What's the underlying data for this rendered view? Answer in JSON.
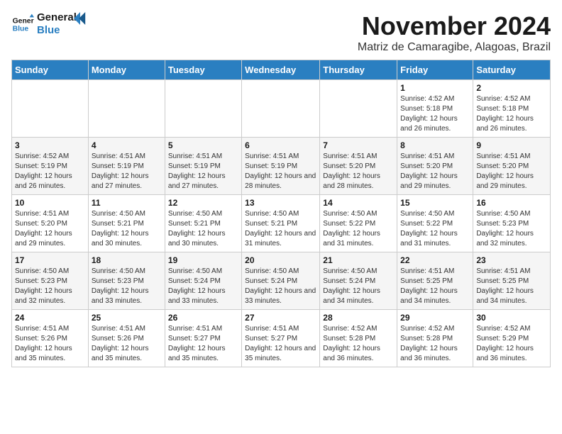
{
  "header": {
    "logo_line1": "General",
    "logo_line2": "Blue",
    "month_title": "November 2024",
    "location": "Matriz de Camaragibe, Alagoas, Brazil"
  },
  "weekdays": [
    "Sunday",
    "Monday",
    "Tuesday",
    "Wednesday",
    "Thursday",
    "Friday",
    "Saturday"
  ],
  "weeks": [
    [
      {
        "day": "",
        "info": ""
      },
      {
        "day": "",
        "info": ""
      },
      {
        "day": "",
        "info": ""
      },
      {
        "day": "",
        "info": ""
      },
      {
        "day": "",
        "info": ""
      },
      {
        "day": "1",
        "info": "Sunrise: 4:52 AM\nSunset: 5:18 PM\nDaylight: 12 hours and 26 minutes."
      },
      {
        "day": "2",
        "info": "Sunrise: 4:52 AM\nSunset: 5:18 PM\nDaylight: 12 hours and 26 minutes."
      }
    ],
    [
      {
        "day": "3",
        "info": "Sunrise: 4:52 AM\nSunset: 5:19 PM\nDaylight: 12 hours and 26 minutes."
      },
      {
        "day": "4",
        "info": "Sunrise: 4:51 AM\nSunset: 5:19 PM\nDaylight: 12 hours and 27 minutes."
      },
      {
        "day": "5",
        "info": "Sunrise: 4:51 AM\nSunset: 5:19 PM\nDaylight: 12 hours and 27 minutes."
      },
      {
        "day": "6",
        "info": "Sunrise: 4:51 AM\nSunset: 5:19 PM\nDaylight: 12 hours and 28 minutes."
      },
      {
        "day": "7",
        "info": "Sunrise: 4:51 AM\nSunset: 5:20 PM\nDaylight: 12 hours and 28 minutes."
      },
      {
        "day": "8",
        "info": "Sunrise: 4:51 AM\nSunset: 5:20 PM\nDaylight: 12 hours and 29 minutes."
      },
      {
        "day": "9",
        "info": "Sunrise: 4:51 AM\nSunset: 5:20 PM\nDaylight: 12 hours and 29 minutes."
      }
    ],
    [
      {
        "day": "10",
        "info": "Sunrise: 4:51 AM\nSunset: 5:20 PM\nDaylight: 12 hours and 29 minutes."
      },
      {
        "day": "11",
        "info": "Sunrise: 4:50 AM\nSunset: 5:21 PM\nDaylight: 12 hours and 30 minutes."
      },
      {
        "day": "12",
        "info": "Sunrise: 4:50 AM\nSunset: 5:21 PM\nDaylight: 12 hours and 30 minutes."
      },
      {
        "day": "13",
        "info": "Sunrise: 4:50 AM\nSunset: 5:21 PM\nDaylight: 12 hours and 31 minutes."
      },
      {
        "day": "14",
        "info": "Sunrise: 4:50 AM\nSunset: 5:22 PM\nDaylight: 12 hours and 31 minutes."
      },
      {
        "day": "15",
        "info": "Sunrise: 4:50 AM\nSunset: 5:22 PM\nDaylight: 12 hours and 31 minutes."
      },
      {
        "day": "16",
        "info": "Sunrise: 4:50 AM\nSunset: 5:23 PM\nDaylight: 12 hours and 32 minutes."
      }
    ],
    [
      {
        "day": "17",
        "info": "Sunrise: 4:50 AM\nSunset: 5:23 PM\nDaylight: 12 hours and 32 minutes."
      },
      {
        "day": "18",
        "info": "Sunrise: 4:50 AM\nSunset: 5:23 PM\nDaylight: 12 hours and 33 minutes."
      },
      {
        "day": "19",
        "info": "Sunrise: 4:50 AM\nSunset: 5:24 PM\nDaylight: 12 hours and 33 minutes."
      },
      {
        "day": "20",
        "info": "Sunrise: 4:50 AM\nSunset: 5:24 PM\nDaylight: 12 hours and 33 minutes."
      },
      {
        "day": "21",
        "info": "Sunrise: 4:50 AM\nSunset: 5:24 PM\nDaylight: 12 hours and 34 minutes."
      },
      {
        "day": "22",
        "info": "Sunrise: 4:51 AM\nSunset: 5:25 PM\nDaylight: 12 hours and 34 minutes."
      },
      {
        "day": "23",
        "info": "Sunrise: 4:51 AM\nSunset: 5:25 PM\nDaylight: 12 hours and 34 minutes."
      }
    ],
    [
      {
        "day": "24",
        "info": "Sunrise: 4:51 AM\nSunset: 5:26 PM\nDaylight: 12 hours and 35 minutes."
      },
      {
        "day": "25",
        "info": "Sunrise: 4:51 AM\nSunset: 5:26 PM\nDaylight: 12 hours and 35 minutes."
      },
      {
        "day": "26",
        "info": "Sunrise: 4:51 AM\nSunset: 5:27 PM\nDaylight: 12 hours and 35 minutes."
      },
      {
        "day": "27",
        "info": "Sunrise: 4:51 AM\nSunset: 5:27 PM\nDaylight: 12 hours and 35 minutes."
      },
      {
        "day": "28",
        "info": "Sunrise: 4:52 AM\nSunset: 5:28 PM\nDaylight: 12 hours and 36 minutes."
      },
      {
        "day": "29",
        "info": "Sunrise: 4:52 AM\nSunset: 5:28 PM\nDaylight: 12 hours and 36 minutes."
      },
      {
        "day": "30",
        "info": "Sunrise: 4:52 AM\nSunset: 5:29 PM\nDaylight: 12 hours and 36 minutes."
      }
    ]
  ]
}
